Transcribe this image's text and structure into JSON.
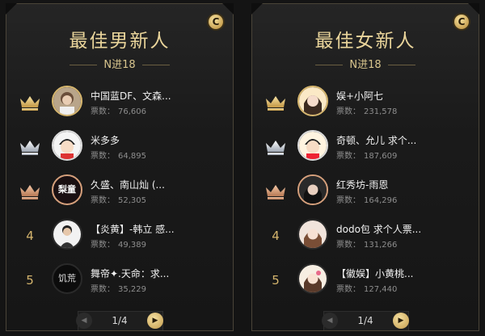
{
  "colors": {
    "gold": "#ead59b",
    "silver": "#dcdcdc",
    "bronze": "#d6a07c",
    "background": "#141414"
  },
  "panels": [
    {
      "title": "最佳男新人",
      "subtitle": "N进18",
      "badge": "C",
      "pager": {
        "text": "1/4",
        "prev_icon": "chevron-left-icon",
        "next_icon": "chevron-right-icon"
      },
      "items": [
        {
          "rank": "1",
          "rank_icon": "gold-crown-icon",
          "name": "中国蓝DF、文森...",
          "votes_label": "票数：",
          "votes": "76,606"
        },
        {
          "rank": "2",
          "rank_icon": "silver-crown-icon",
          "name": "米多多",
          "votes_label": "票数：",
          "votes": "64,895"
        },
        {
          "rank": "3",
          "rank_icon": "bronze-crown-icon",
          "name": "久盛、南山灿 (...",
          "votes_label": "票数：",
          "votes": "52,305",
          "avatar_text": "梨童"
        },
        {
          "rank": "4",
          "name": "【炎黄】-韩立 感...",
          "votes_label": "票数：",
          "votes": "49,389"
        },
        {
          "rank": "5",
          "name": "舞帝✦.天命：求...",
          "votes_label": "票数：",
          "votes": "35,229",
          "avatar_text": "饥荒"
        }
      ]
    },
    {
      "title": "最佳女新人",
      "subtitle": "N进18",
      "badge": "C",
      "pager": {
        "text": "1/4",
        "prev_icon": "chevron-left-icon",
        "next_icon": "chevron-right-icon"
      },
      "items": [
        {
          "rank": "1",
          "rank_icon": "gold-crown-icon",
          "name": "娱+小阿七",
          "votes_label": "票数：",
          "votes": "231,578"
        },
        {
          "rank": "2",
          "rank_icon": "silver-crown-icon",
          "name": "奇顿、允儿 求个...",
          "votes_label": "票数：",
          "votes": "187,609"
        },
        {
          "rank": "3",
          "rank_icon": "bronze-crown-icon",
          "name": "红秀坊-雨恩",
          "votes_label": "票数：",
          "votes": "164,296"
        },
        {
          "rank": "4",
          "name": "dodo包 求个人票...",
          "votes_label": "票数：",
          "votes": "131,266"
        },
        {
          "rank": "5",
          "name": "【徽娱】小黄桃...",
          "votes_label": "票数：",
          "votes": "127,440"
        }
      ]
    }
  ]
}
